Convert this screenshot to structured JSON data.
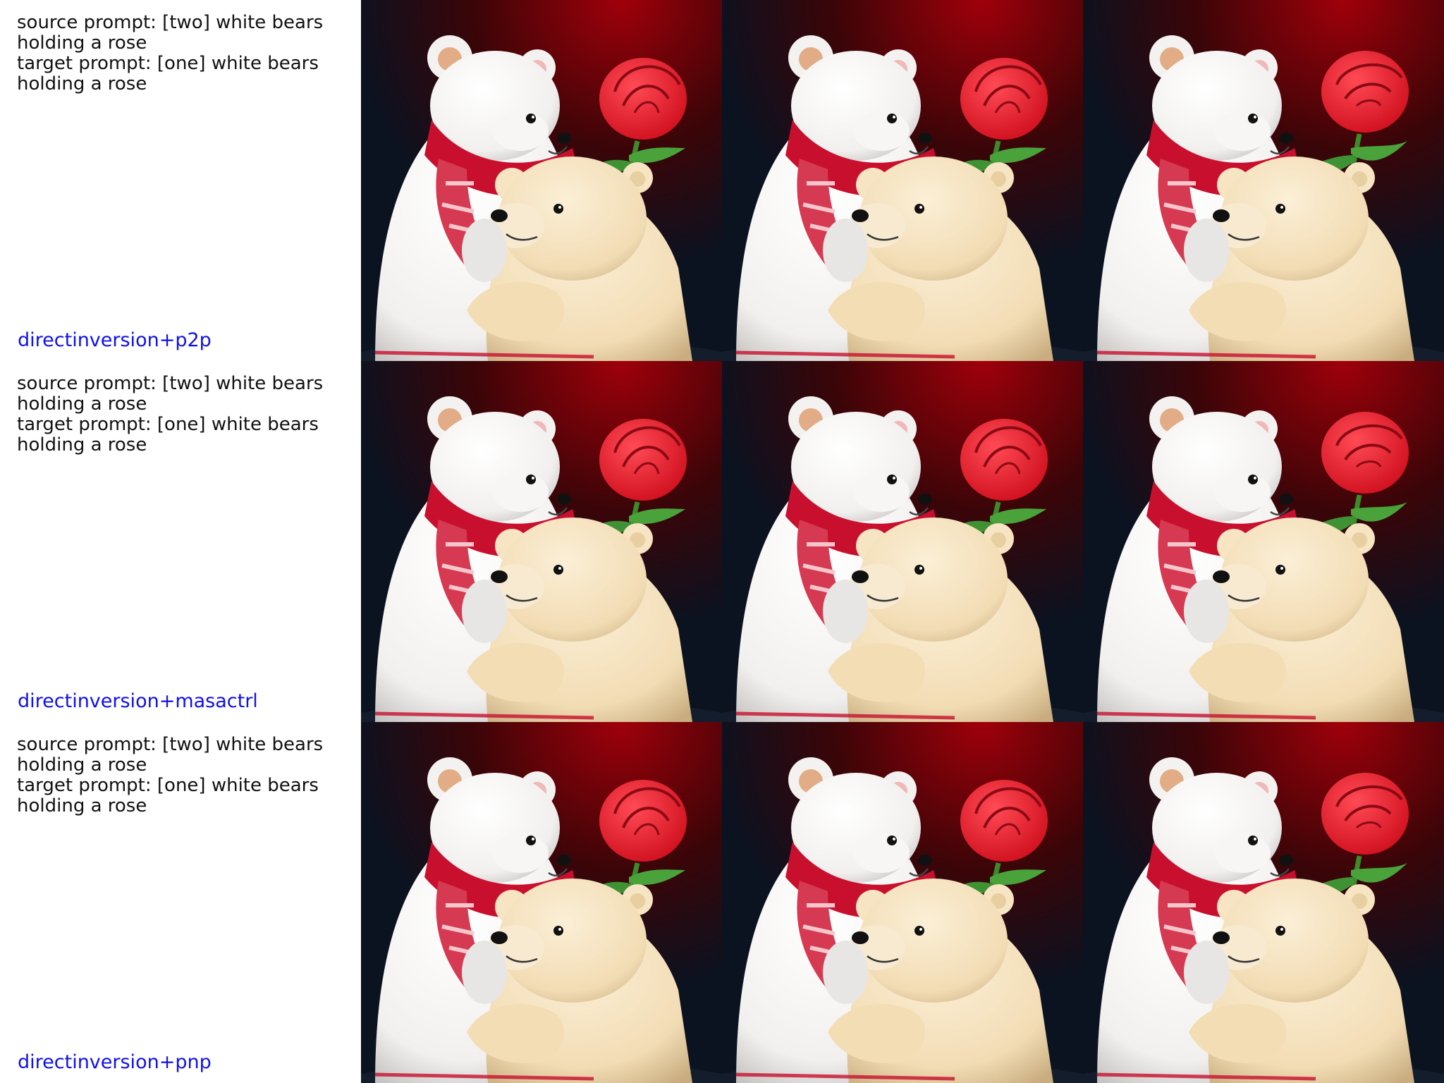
{
  "rows": [
    {
      "prompt": "source prompt: [two] white bears\nholding a rose\ntarget prompt: [one] white bears\nholding a rose",
      "method": "directinversion+p2p",
      "images": [
        {
          "content": "teddy-bears-rose",
          "variant": "source"
        },
        {
          "content": "teddy-bears-rose",
          "variant": "reconstruction"
        },
        {
          "content": "teddy-bears-rose",
          "variant": "edited"
        }
      ]
    },
    {
      "prompt": "source prompt: [two] white bears\nholding a rose\ntarget prompt: [one] white bears\nholding a rose",
      "method": "directinversion+masactrl",
      "images": [
        {
          "content": "teddy-bears-rose",
          "variant": "source"
        },
        {
          "content": "teddy-bears-rose",
          "variant": "reconstruction"
        },
        {
          "content": "teddy-bears-rose",
          "variant": "edited"
        }
      ]
    },
    {
      "prompt": "source prompt: [two] white bears\nholding a rose\ntarget prompt: [one] white bears\nholding a rose",
      "method": "directinversion+pnp",
      "images": [
        {
          "content": "teddy-bears-rose",
          "variant": "source"
        },
        {
          "content": "teddy-bears-rose",
          "variant": "reconstruction"
        },
        {
          "content": "teddy-bears-rose",
          "variant": "edited"
        }
      ]
    }
  ],
  "colors": {
    "method_label": "#1010ee",
    "prompt_text": "#111111",
    "background_dark": "#0b1220",
    "background_red": "#a0000a",
    "white_bear": "#f2f0ee",
    "cream_bear": "#f2dcb4",
    "scarf": "#c8102e",
    "rose": "#d0101e",
    "stem": "#3d8a2a"
  }
}
